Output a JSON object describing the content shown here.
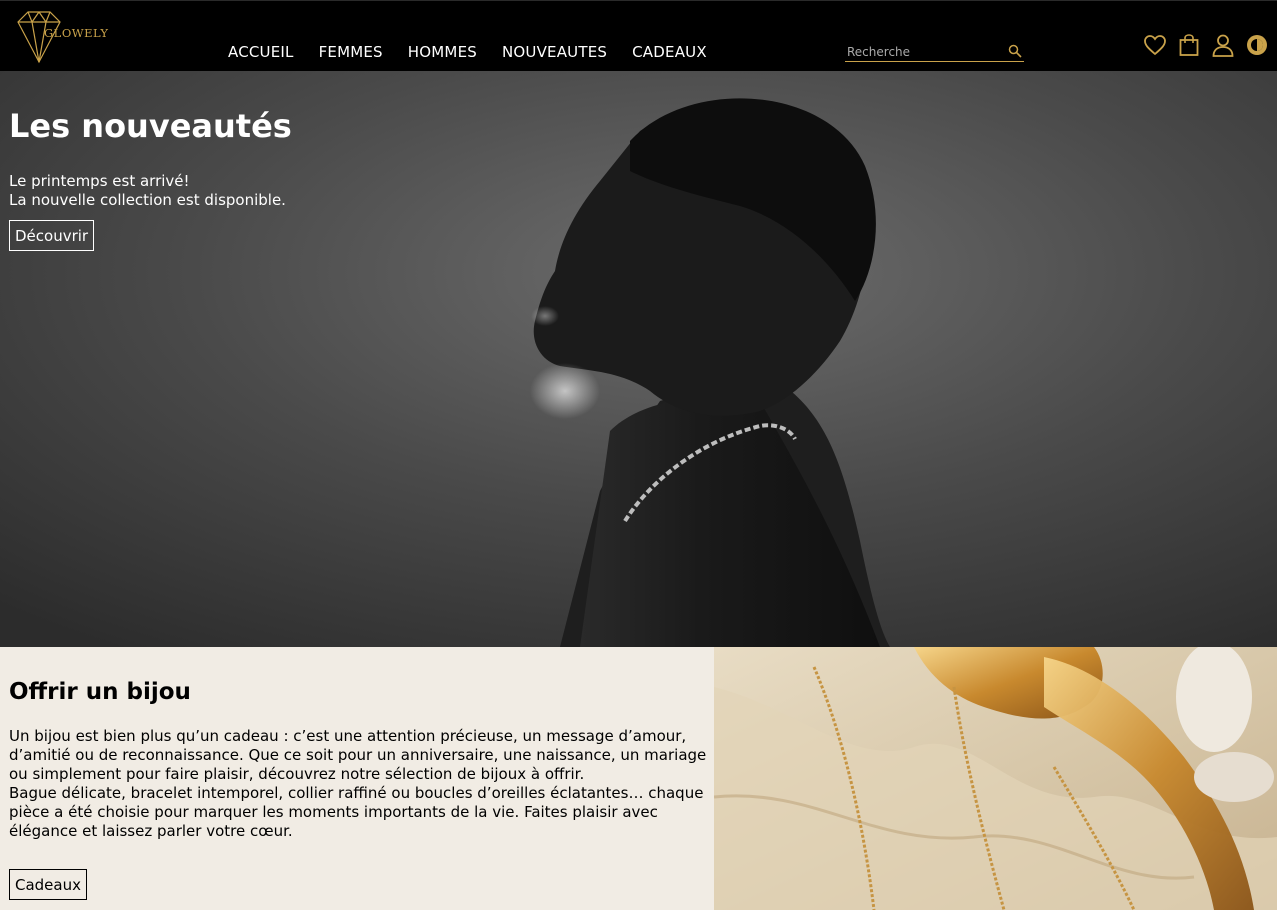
{
  "brand": {
    "name": "GLOWELY",
    "gold": "#c9a24a"
  },
  "nav": {
    "items": [
      {
        "label": "ACCUEIL"
      },
      {
        "label": "FEMMES"
      },
      {
        "label": "HOMMES"
      },
      {
        "label": "NOUVEAUTES"
      },
      {
        "label": "CADEAUX"
      }
    ]
  },
  "search": {
    "placeholder": "Recherche",
    "icon": "search-icon"
  },
  "header_icons": [
    "heart-icon",
    "shopping-bag-icon",
    "user-icon",
    "theme-toggle-icon"
  ],
  "hero": {
    "title": "Les nouveautés",
    "line1": "Le printemps est arrivé!",
    "line2": "La nouvelle collection est disponible.",
    "button": "Découvrir"
  },
  "gift": {
    "title": "Offrir un bijou",
    "paragraph1": "Un bijou est bien plus qu’un cadeau : c’est une attention précieuse, un message d’amour, d’amitié ou de reconnaissance. Que ce soit pour un anniversaire, une naissance, un mariage ou simplement pour faire plaisir, découvrez notre sélection de bijoux à offrir.",
    "paragraph2": "Bague délicate, bracelet intemporel, collier raffiné ou boucles d’oreilles éclatantes… chaque pièce a été choisie pour marquer les moments importants de la vie. Faites plaisir avec élégance et laissez parler votre cœur.",
    "button": "Cadeaux",
    "background": "#f1ece4"
  }
}
